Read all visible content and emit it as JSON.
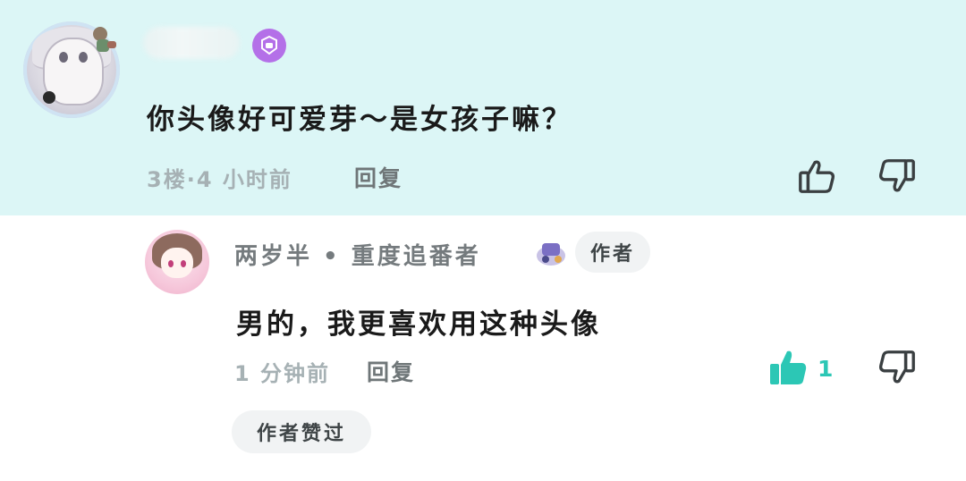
{
  "top_comment": {
    "text": "你头像好可爱芽～是女孩子嘛？",
    "meta": "3楼·4 小时前",
    "reply_label": "回复",
    "colors": {
      "background": "#dcf6f6",
      "level_badge": "#b470e8"
    },
    "icons": [
      "level-badge-icon",
      "thumbs-up-icon",
      "thumbs-down-icon"
    ]
  },
  "reply_comment": {
    "username": "两岁半 • 重度追番者",
    "author_tag": "作者",
    "text": "男的，我更喜欢用这种头像",
    "meta": "1 分钟前",
    "reply_label": "回复",
    "like_count": "1",
    "liked": true,
    "author_liked_label": "作者赞过",
    "colors": {
      "liked": "#2cc7b5",
      "tag_bg": "#f1f3f4"
    },
    "icons": [
      "fan-medal-icon",
      "thumbs-up-filled-icon",
      "thumbs-down-icon"
    ]
  }
}
